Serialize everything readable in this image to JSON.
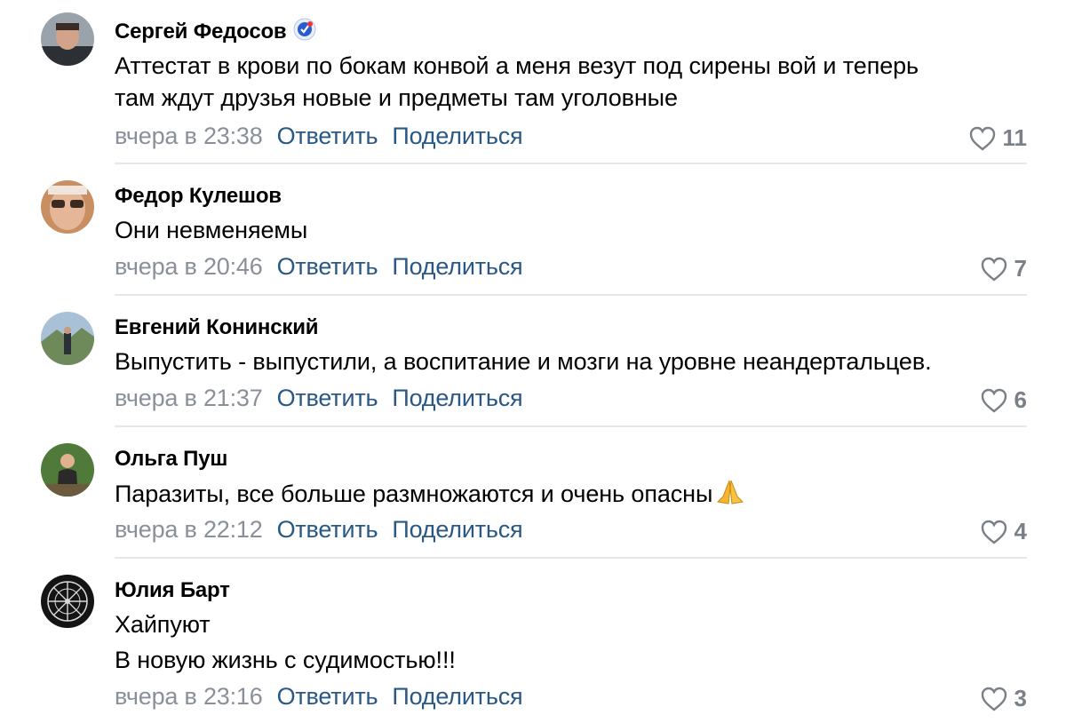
{
  "comments": [
    {
      "author": "Сергей Федосов",
      "lines": [
        "Аттестат в крови по бокам конвой а меня везут под сирены вой и теперь",
        "там ждут друзья новые и предметы там уголовные"
      ],
      "time": "вчера в 23:38",
      "reply": "Ответить",
      "share": "Поделиться",
      "likes": "11",
      "verified_icon": "verified-badge-icon"
    },
    {
      "author": "Федор Кулешов",
      "lines": [
        "Они невменяемы"
      ],
      "time": "вчера в 20:46",
      "reply": "Ответить",
      "share": "Поделиться",
      "likes": "7"
    },
    {
      "author": "Евгений Конинский",
      "lines": [
        "Выпустить - выпустили, а воспитание и мозги на уровне неандертальцев."
      ],
      "time": "вчера в 21:37",
      "reply": "Ответить",
      "share": "Поделиться",
      "likes": "6"
    },
    {
      "author": "Ольга Пуш",
      "lines": [
        "Паразиты, все больше размножаются и очень опасны"
      ],
      "emoji": "folded-hands-emoji",
      "time": "вчера в 22:12",
      "reply": "Ответить",
      "share": "Поделиться",
      "likes": "4"
    },
    {
      "author": "Юлия Барт",
      "lines": [
        "Хайпуют",
        "В новую жизнь с судимостью!!!"
      ],
      "time": "вчера в 23:16",
      "reply": "Ответить",
      "share": "Поделиться",
      "likes": "3"
    }
  ],
  "colors": {
    "link": "#2a5885",
    "meta": "#8a9099",
    "divider": "#e7e8ec",
    "likes": "#7b8088"
  }
}
